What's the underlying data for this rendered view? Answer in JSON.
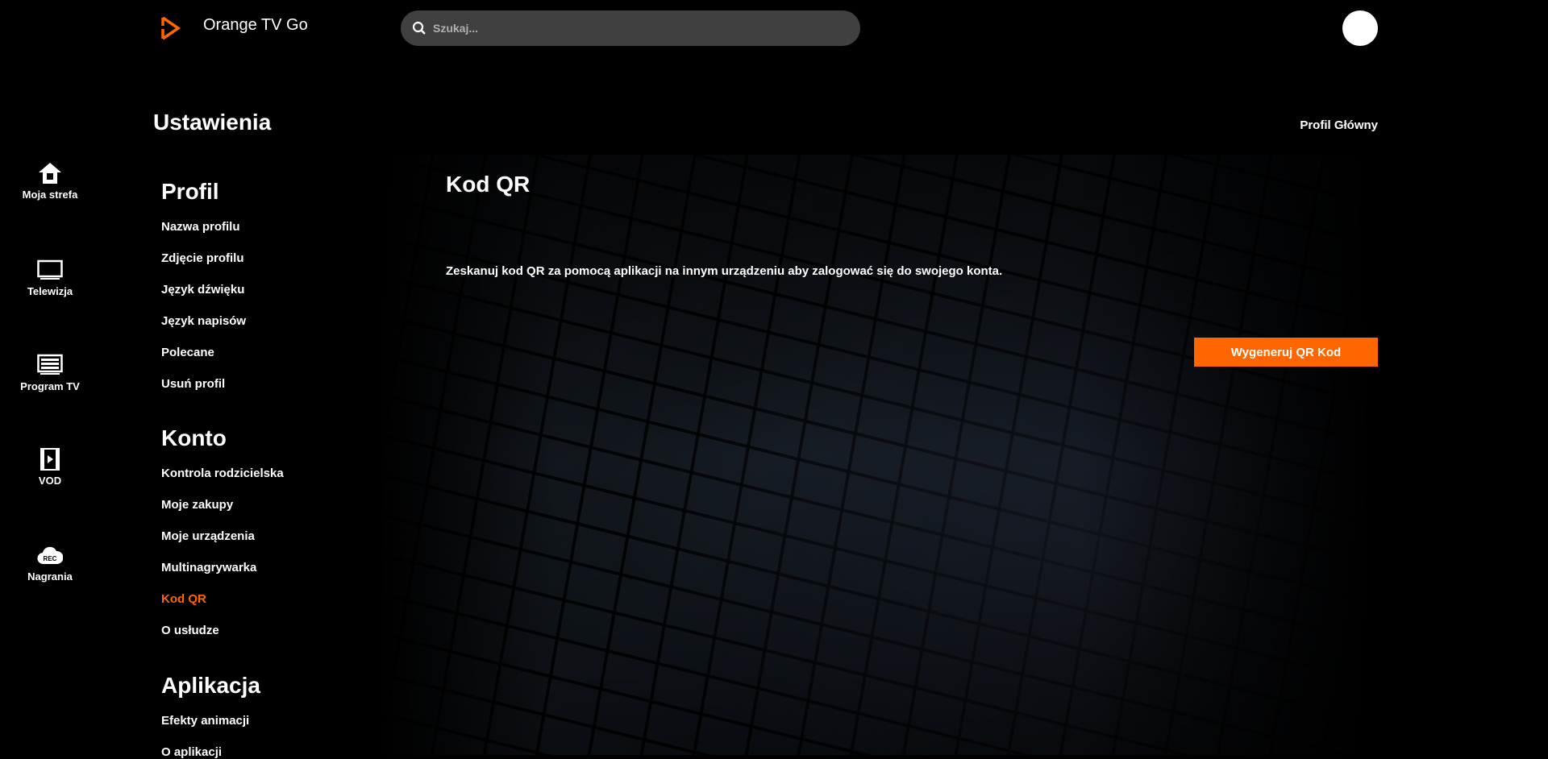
{
  "header": {
    "app_title": "Orange TV Go",
    "search_placeholder": "Szukaj...",
    "brand_color": "#ff6600"
  },
  "page": {
    "title": "Ustawienia",
    "profile_name": "Profil Główny"
  },
  "nav": [
    {
      "label": "Moja strefa",
      "icon": "home-icon"
    },
    {
      "label": "Telewizja",
      "icon": "tv-icon"
    },
    {
      "label": "Program TV",
      "icon": "tv-guide-icon"
    },
    {
      "label": "VOD",
      "icon": "film-icon"
    },
    {
      "label": "Nagrania",
      "icon": "rec-cloud-icon",
      "badge": "REC"
    }
  ],
  "menu": {
    "sections": [
      {
        "title": "Profil",
        "items": [
          "Nazwa profilu",
          "Zdjęcie profilu",
          "Język dźwięku",
          "Język napisów",
          "Polecane",
          "Usuń profil"
        ]
      },
      {
        "title": "Konto",
        "items": [
          "Kontrola rodzicielska",
          "Moje zakupy",
          "Moje urządzenia",
          "Multinagrywarka",
          "Kod QR",
          "O usłudze"
        ]
      },
      {
        "title": "Aplikacja",
        "items": [
          "Efekty animacji",
          "O aplikacji"
        ]
      }
    ],
    "active_item": "Kod QR"
  },
  "content": {
    "title": "Kod QR",
    "description": "Zeskanuj kod QR za pomocą aplikacji na innym urządzeniu aby zalogować się do swojego konta.",
    "button_label": "Wygeneruj QR Kod"
  }
}
